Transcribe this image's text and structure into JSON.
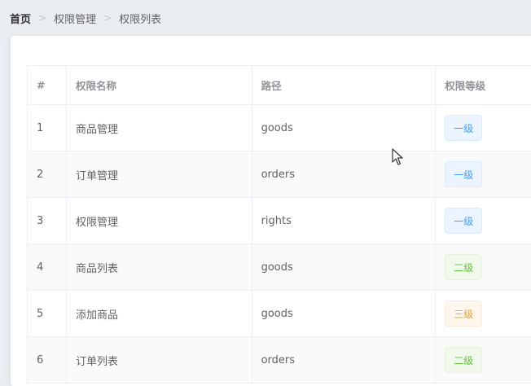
{
  "breadcrumb": {
    "home": "首页",
    "section": "权限管理",
    "page": "权限列表"
  },
  "table": {
    "columns": [
      "#",
      "权限名称",
      "路径",
      "权限等级"
    ],
    "rows": [
      {
        "index": "1",
        "name": "商品管理",
        "path": "goods",
        "level": "一级"
      },
      {
        "index": "2",
        "name": "订单管理",
        "path": "orders",
        "level": "一级"
      },
      {
        "index": "3",
        "name": "权限管理",
        "path": "rights",
        "level": "一级"
      },
      {
        "index": "4",
        "name": "商品列表",
        "path": "goods",
        "level": "二级"
      },
      {
        "index": "5",
        "name": "添加商品",
        "path": "goods",
        "level": "三级"
      },
      {
        "index": "6",
        "name": "订单列表",
        "path": "orders",
        "level": "二级"
      }
    ]
  },
  "colors": {
    "level1": "#409eff",
    "level2": "#67c23a",
    "level3": "#e6a23c"
  }
}
